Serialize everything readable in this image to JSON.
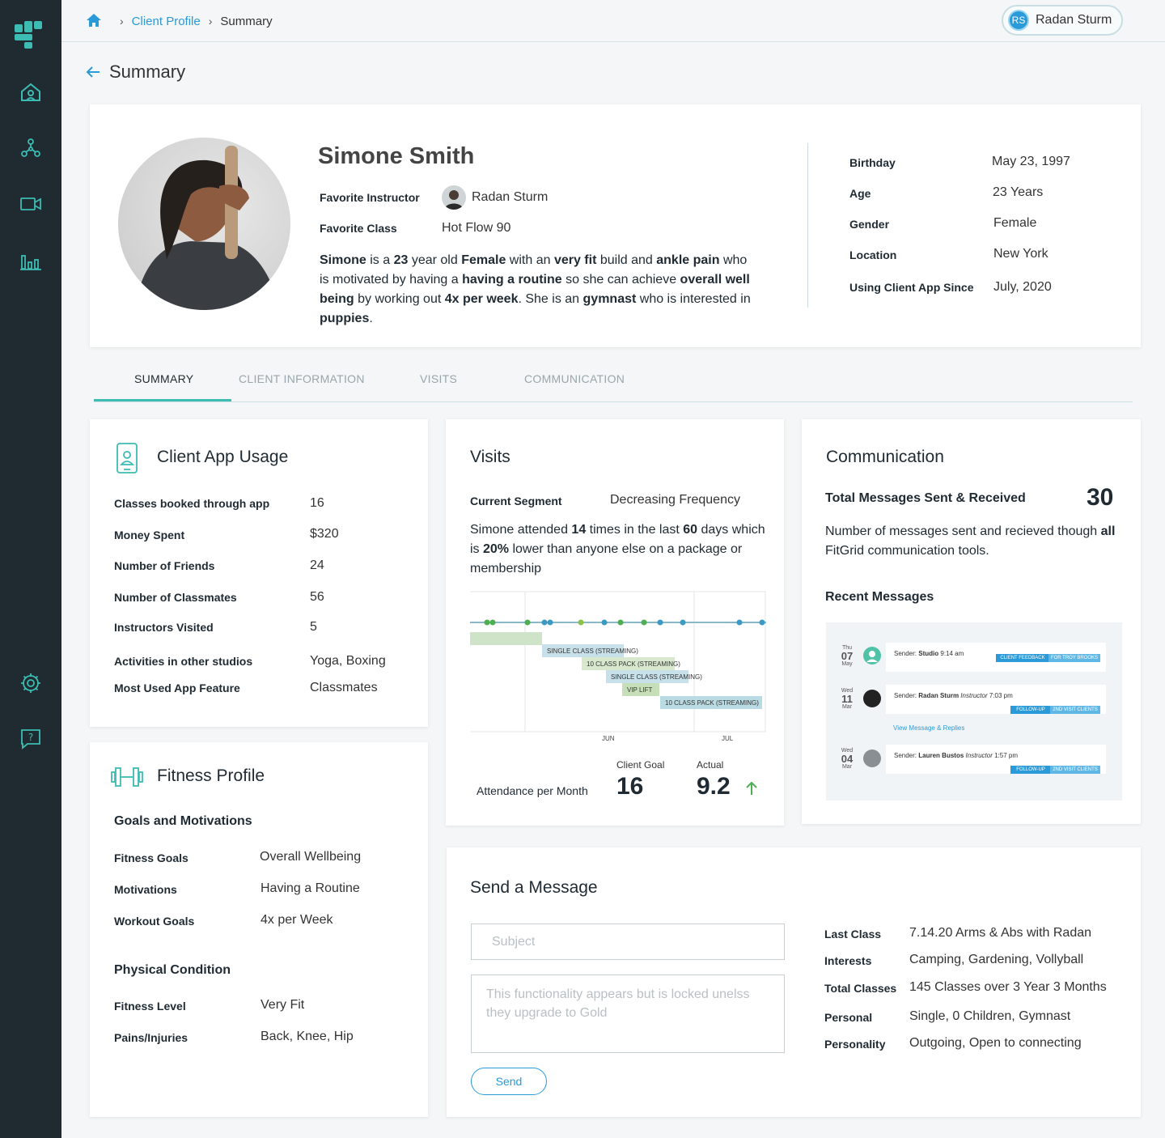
{
  "breadcrumb": {
    "client_profile": "Client Profile",
    "summary": "Summary"
  },
  "user": {
    "initials": "RS",
    "name": "Radan Sturm"
  },
  "page": {
    "title": "Summary"
  },
  "profile": {
    "name": "Simone Smith",
    "favorite_instructor_label": "Favorite Instructor",
    "favorite_instructor": "Radan Sturm",
    "favorite_class_label": "Favorite Class",
    "favorite_class": "Hot Flow 90",
    "bio": [
      "Simone",
      " is a ",
      "23",
      " year old ",
      "Female",
      " with an ",
      "very fit",
      " build and ",
      "ankle pain",
      " who is motivated by having a ",
      "having a routine",
      " so she can achieve ",
      "overall well being",
      " by working out ",
      "4x per week",
      ". She is an ",
      "gymnast",
      " who is interested in ",
      "puppies",
      "."
    ],
    "details": [
      {
        "label": "Birthday",
        "value": "May 23, 1997"
      },
      {
        "label": "Age",
        "value": "23 Years"
      },
      {
        "label": "Gender",
        "value": "Female"
      },
      {
        "label": "Location",
        "value": "New York"
      },
      {
        "label": "Using Client  App Since",
        "value": "July, 2020"
      }
    ]
  },
  "tabs": [
    "SUMMARY",
    "CLIENT INFORMATION",
    "VISITS",
    "COMMUNICATION"
  ],
  "app_usage": {
    "title": "Client App Usage",
    "rows": [
      {
        "label": "Classes booked through app",
        "value": "16"
      },
      {
        "label": "Money Spent",
        "value": "$320"
      },
      {
        "label": "Number of Friends",
        "value": "24"
      },
      {
        "label": "Number of Classmates",
        "value": "56"
      },
      {
        "label": "Instructors Visited",
        "value": "5"
      },
      {
        "label": "Activities in other studios",
        "value": "Yoga, Boxing"
      },
      {
        "label": "Most Used App Feature",
        "value": "Classmates"
      }
    ]
  },
  "visits": {
    "title": "Visits",
    "segment_label": "Current Segment",
    "segment_value": "Decreasing Frequency",
    "text": [
      "Simone attended ",
      "14",
      " times in the last ",
      "60",
      " days which is ",
      "20%",
      " lower than anyone else on a package or membership"
    ],
    "bars": [
      "SINGLE CLASS (STREAMING)",
      "10 CLASS PACK (STREAMING)",
      "SINGLE  CLASS (STREAMING)",
      "VIP LIFT",
      "10 CLASS PACK (STREAMING)"
    ],
    "months": [
      "JUN",
      "JUL"
    ],
    "attendance_label": "Attendance per Month",
    "goal_label": "Client Goal",
    "goal_value": "16",
    "actual_label": "Actual",
    "actual_value": "9.2"
  },
  "communication": {
    "title": "Communication",
    "total_label": "Total Messages Sent & Received",
    "total_value": "30",
    "desc_pre": "Number of messages sent and recieved though ",
    "desc_bold": "all",
    "desc_post": " FitGrid communication tools.",
    "recent_label": "Recent Messages",
    "messages": [
      {
        "day": "Thu",
        "date": "07",
        "month": "May",
        "sender_label": "Sender:",
        "sender": "Studio",
        "role": "",
        "time": "9:14 am",
        "tags": [
          "CLIENT FEEDBACK",
          "FOR TROY BROOKS"
        ]
      },
      {
        "day": "Wed",
        "date": "11",
        "month": "Mar",
        "sender_label": "Sender:",
        "sender": "Radan Sturm",
        "role": "Instructor",
        "time": "7:03 pm",
        "tags": [
          "FOLLOW-UP",
          "2ND VISIT CLIENTS"
        ]
      },
      {
        "day": "Wed",
        "date": "04",
        "month": "Mar",
        "sender_label": "Sender:",
        "sender": "Lauren Bustos",
        "role": "Instructor",
        "time": "1:57 pm",
        "tags": [
          "FOLLOW-UP",
          "2ND VISIT CLIENTS"
        ]
      }
    ],
    "view_replies": "View Message & Replies"
  },
  "fitness": {
    "title": "Fitness Profile",
    "goals_heading": "Goals and Motivations",
    "goals": [
      {
        "label": "Fitness Goals",
        "value": "Overall Wellbeing"
      },
      {
        "label": "Motivations",
        "value": "Having a Routine"
      },
      {
        "label": "Workout Goals",
        "value": "4x per Week"
      }
    ],
    "physical_heading": "Physical Condition",
    "physical": [
      {
        "label": "Fitness Level",
        "value": "Very Fit"
      },
      {
        "label": "Pains/Injuries",
        "value": "Back, Knee, Hip"
      }
    ]
  },
  "message": {
    "title": "Send a Message",
    "subject_placeholder": "Subject",
    "body_placeholder": "This functionality appears but is locked unelss they upgrade to Gold",
    "send": "Send",
    "info": [
      {
        "label": "Last Class",
        "value": "7.14.20 Arms & Abs with Radan"
      },
      {
        "label": "Interests",
        "value": "Camping, Gardening, Vollyball"
      },
      {
        "label": "Total Classes",
        "value": "145 Classes over 3 Year 3 Months"
      },
      {
        "label": "Personal",
        "value": "Single, 0 Children, Gymnast"
      },
      {
        "label": "Personality",
        "value": "Outgoing, Open to connecting"
      }
    ]
  },
  "colors": {
    "sidebar": "#1f2b30",
    "accent_teal": "#3cbcb3",
    "link_blue": "#2a9ad8"
  }
}
